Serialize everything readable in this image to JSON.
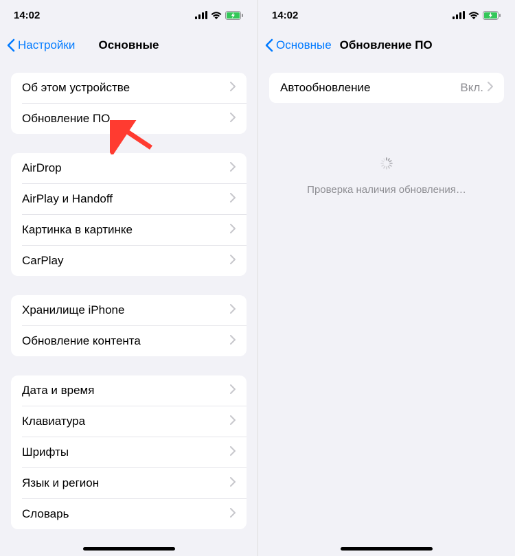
{
  "status": {
    "time": "14:02",
    "signal_label": "signal",
    "wifi_label": "wifi",
    "battery_label": "battery"
  },
  "screen_left": {
    "back_label": "Настройки",
    "title": "Основные",
    "groups": [
      {
        "items": [
          {
            "label": "Об этом устройстве",
            "name": "about-device"
          },
          {
            "label": "Обновление ПО",
            "name": "software-update"
          }
        ]
      },
      {
        "items": [
          {
            "label": "AirDrop",
            "name": "airdrop"
          },
          {
            "label": "AirPlay и Handoff",
            "name": "airplay-handoff"
          },
          {
            "label": "Картинка в картинке",
            "name": "picture-in-picture"
          },
          {
            "label": "CarPlay",
            "name": "carplay"
          }
        ]
      },
      {
        "items": [
          {
            "label": "Хранилище iPhone",
            "name": "iphone-storage"
          },
          {
            "label": "Обновление контента",
            "name": "background-app-refresh"
          }
        ]
      },
      {
        "items": [
          {
            "label": "Дата и время",
            "name": "date-time"
          },
          {
            "label": "Клавиатура",
            "name": "keyboard"
          },
          {
            "label": "Шрифты",
            "name": "fonts"
          },
          {
            "label": "Язык и регион",
            "name": "language-region"
          },
          {
            "label": "Словарь",
            "name": "dictionary"
          }
        ]
      }
    ]
  },
  "screen_right": {
    "back_label": "Основные",
    "title": "Обновление ПО",
    "auto_update": {
      "label": "Автообновление",
      "value": "Вкл."
    },
    "loading_text": "Проверка наличия обновления…"
  }
}
